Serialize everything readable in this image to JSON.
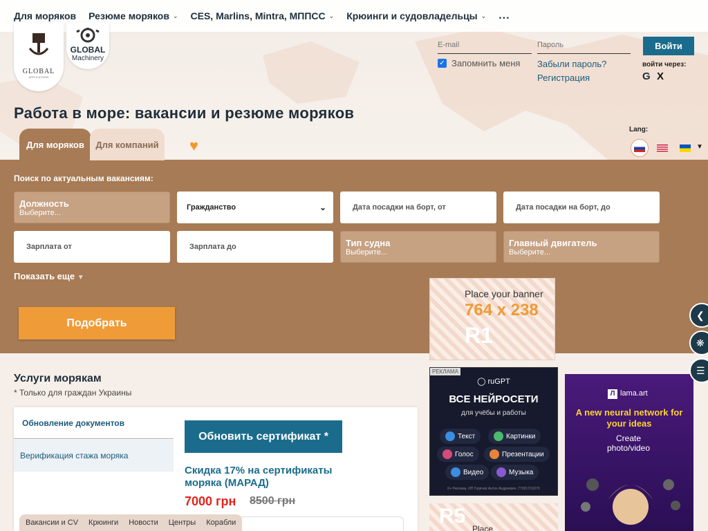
{
  "nav": {
    "items": [
      "Для моряков",
      "Резюме моряков",
      "CES, Marlins, Mintra, МППСС",
      "Крюинги и судовладельцы"
    ],
    "more": "..."
  },
  "logos": {
    "global_top": "GLOBAL",
    "global_sub": "APPLICATIONS",
    "machinery_title": "GLOBAL",
    "machinery_sub": "Machinery"
  },
  "login": {
    "email_placeholder": "E-mail",
    "password_placeholder": "Пароль",
    "submit": "Войти",
    "remember": "Запомнить меня",
    "forgot": "Забыли пароль?",
    "register": "Регистрация",
    "via": "войти через:",
    "google": "G",
    "x": "X"
  },
  "page_title": "Работа в море: вакансии и резюме моряков",
  "tabs": [
    "Для моряков",
    "Для компаний"
  ],
  "lang": {
    "label": "Lang:",
    "flags": [
      "russia-flag-icon",
      "usa-flag-icon",
      "ukraine-flag-icon"
    ]
  },
  "search": {
    "label": "Поиск по актуальным вакансиям:",
    "position": {
      "title": "Должность",
      "value": "Выберите..."
    },
    "citizenship": "Гражданство",
    "date_from": "Дата посадки на борт, от",
    "date_to": "Дата посадки на борт, до",
    "salary_from": "Зарплата от",
    "salary_to": "Зарплата до",
    "vessel_type": {
      "title": "Тип судна",
      "value": "Выберите..."
    },
    "main_engine": {
      "title": "Главный двигатель",
      "value": "Выберите..."
    },
    "show_more": "Показать еще",
    "submit": "Подобрать"
  },
  "banner_r1": {
    "place": "Place your banner",
    "size": "764 x 238",
    "code": "R1"
  },
  "ad_rugpt": {
    "tag": "РЕКЛАМА",
    "brand": "ruGPT",
    "headline": "ВСЕ НЕЙРОСЕТИ",
    "sub": "для учёбы и работы",
    "pills": [
      "Текст",
      "Картинки",
      "Голос",
      "Презентации",
      "Видео",
      "Музыка"
    ],
    "fineprint": "0+ Реклама. ИП Горячев Антон Андреевич. 770017С6379"
  },
  "ad_lama": {
    "brand": "lama.art",
    "headline": "A new neural network for your ideas",
    "sub": "Create photo/video"
  },
  "banner_r5": {
    "code": "R5",
    "place": "Place"
  },
  "services": {
    "title": "Услуги морякам",
    "note": "* Только для граждан Украины",
    "tab_active": "Обновление документов",
    "tab_inactive": "Верификация стажа моряка",
    "cert_button": "Обновить сертификат *",
    "promo": "Скидка 17% на сертификаты моряка (МАРАД)",
    "price": "7000 грн",
    "old_price": "8500 грн"
  },
  "bottom_tabs": [
    "Вакансии и CV",
    "Крюинги",
    "Новости",
    "Центры",
    "Корабли"
  ],
  "colors": {
    "brown": "#a77b55",
    "orange": "#ef9b38",
    "teal": "#1b6c8c",
    "red": "#e2231a"
  }
}
